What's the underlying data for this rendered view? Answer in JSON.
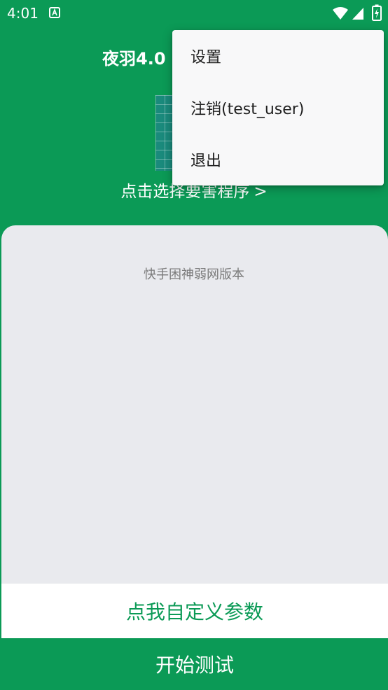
{
  "status_bar": {
    "time": "4:01",
    "notification_icon": "a-notification-icon",
    "wifi_icon": "wifi-icon",
    "signal_icon": "cellular-signal-icon",
    "battery_icon": "battery-charging-icon"
  },
  "header": {
    "title": "夜羽4.0",
    "logo_icon": "app-logo-grid-icon",
    "select_target_label": "点击选择要害程序",
    "select_target_arrow": ">"
  },
  "main": {
    "version_label": "快手困神弱网版本"
  },
  "actions": {
    "custom_params_label": "点我自定义参数",
    "start_test_label": "开始测试"
  },
  "menu": {
    "items": [
      {
        "label": "设置"
      },
      {
        "label": "注销(test_user)"
      },
      {
        "label": "退出"
      }
    ]
  },
  "colors": {
    "primary_green": "#0b9a56",
    "card_background": "#e9eaee",
    "menu_background": "#f8f8f9"
  }
}
